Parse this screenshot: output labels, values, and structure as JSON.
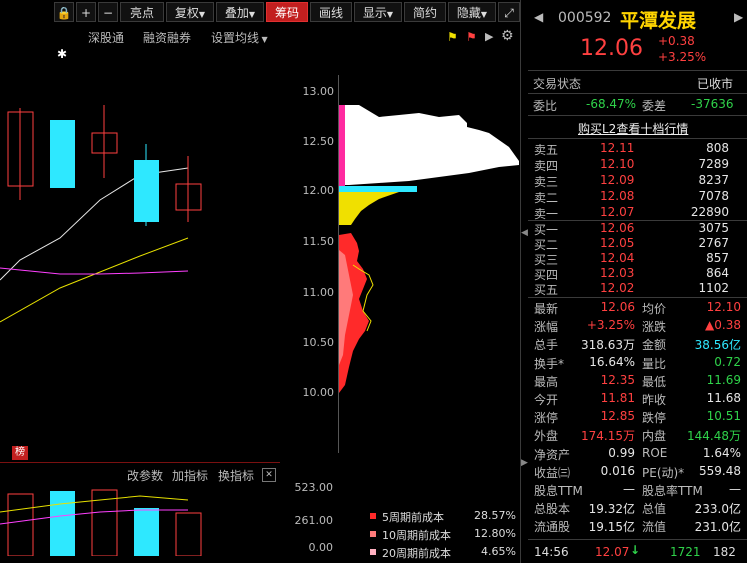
{
  "toolbar": {
    "buttons": [
      "亮点",
      "复权",
      "叠加",
      "筹码",
      "画线",
      "显示",
      "简约",
      "隐藏"
    ],
    "active": "筹码"
  },
  "submenu": {
    "shengutong": "深股通",
    "rongzi": "融资融券",
    "shezhi": "设置均线"
  },
  "price_ticks": [
    "13.00",
    "12.50",
    "12.00",
    "11.50",
    "11.00",
    "10.50",
    "10.00"
  ],
  "vol_ticks": [
    "523.00",
    "261.00",
    "0.00"
  ],
  "lower_menu": {
    "params": "改参数",
    "add": "加指标",
    "switch": "换指标",
    "badge": "榜"
  },
  "chip_legend": [
    {
      "label": "5周期前成本",
      "pct": "28.57%",
      "color": "#ff2a2a"
    },
    {
      "label": "10周期前成本",
      "pct": "12.80%",
      "color": "#ff7a7a"
    },
    {
      "label": "20周期前成本",
      "pct": "4.65%",
      "color": "#ffb0c0"
    }
  ],
  "stock": {
    "code": "000592",
    "name": "平潭发展",
    "price": "12.06",
    "change": "+0.38",
    "change_pct": "+3.25%"
  },
  "status": {
    "label": "交易状态",
    "value": "已收市"
  },
  "weibi": {
    "label1": "委比",
    "val1": "-68.47%",
    "label2": "委差",
    "val2": "-37636"
  },
  "l2_link": "购买L2查看十档行情",
  "sells": [
    {
      "label": "卖五",
      "price": "12.11",
      "vol": "808"
    },
    {
      "label": "卖四",
      "price": "12.10",
      "vol": "7289"
    },
    {
      "label": "卖三",
      "price": "12.09",
      "vol": "8237"
    },
    {
      "label": "卖二",
      "price": "12.08",
      "vol": "7078"
    },
    {
      "label": "卖一",
      "price": "12.07",
      "vol": "22890"
    }
  ],
  "buys": [
    {
      "label": "买一",
      "price": "12.06",
      "vol": "3075"
    },
    {
      "label": "买二",
      "price": "12.05",
      "vol": "2767"
    },
    {
      "label": "买三",
      "price": "12.04",
      "vol": "857"
    },
    {
      "label": "买四",
      "price": "12.03",
      "vol": "864"
    },
    {
      "label": "买五",
      "price": "12.02",
      "vol": "1102"
    }
  ],
  "quote": [
    {
      "l1": "最新",
      "v1": "12.06",
      "c1": "red",
      "l2": "均价",
      "v2": "12.10",
      "c2": "red"
    },
    {
      "l1": "涨幅",
      "v1": "+3.25%",
      "c1": "red",
      "l2": "涨跌",
      "v2": "▲0.38",
      "c2": "red"
    },
    {
      "l1": "总手",
      "v1": "318.63万",
      "c1": "white",
      "l2": "金额",
      "v2": "38.56亿",
      "c2": "cyan"
    },
    {
      "l1": "换手*",
      "v1": "16.64%",
      "c1": "white",
      "l2": "量比",
      "v2": "0.72",
      "c2": "green"
    },
    {
      "l1": "最高",
      "v1": "12.35",
      "c1": "red",
      "l2": "最低",
      "v2": "11.69",
      "c2": "green"
    },
    {
      "l1": "今开",
      "v1": "11.81",
      "c1": "red",
      "l2": "昨收",
      "v2": "11.68",
      "c2": "white"
    },
    {
      "l1": "涨停",
      "v1": "12.85",
      "c1": "red",
      "l2": "跌停",
      "v2": "10.51",
      "c2": "green"
    },
    {
      "l1": "外盘",
      "v1": "174.15万",
      "c1": "red",
      "l2": "内盘",
      "v2": "144.48万",
      "c2": "green"
    },
    {
      "l1": "净资产",
      "v1": "0.99",
      "c1": "white",
      "l2": "ROE",
      "v2": "1.64%",
      "c2": "white"
    },
    {
      "l1": "收益㈢",
      "v1": "0.016",
      "c1": "white",
      "l2": "PE(动)*",
      "v2": "559.48",
      "c2": "white"
    },
    {
      "l1": "股息TTM",
      "v1": "—",
      "c1": "white",
      "l2": "股息率TTM",
      "v2": "—",
      "c2": "white"
    },
    {
      "l1": "总股本",
      "v1": "19.32亿",
      "c1": "white",
      "l2": "总值",
      "v2": "233.0亿",
      "c2": "white"
    },
    {
      "l1": "流通股",
      "v1": "19.15亿",
      "c1": "white",
      "l2": "流值",
      "v2": "231.0亿",
      "c2": "white"
    }
  ],
  "tick": {
    "time": "14:56",
    "price": "12.07",
    "arrow": "↓",
    "vol": "1721",
    "num": "182"
  }
}
